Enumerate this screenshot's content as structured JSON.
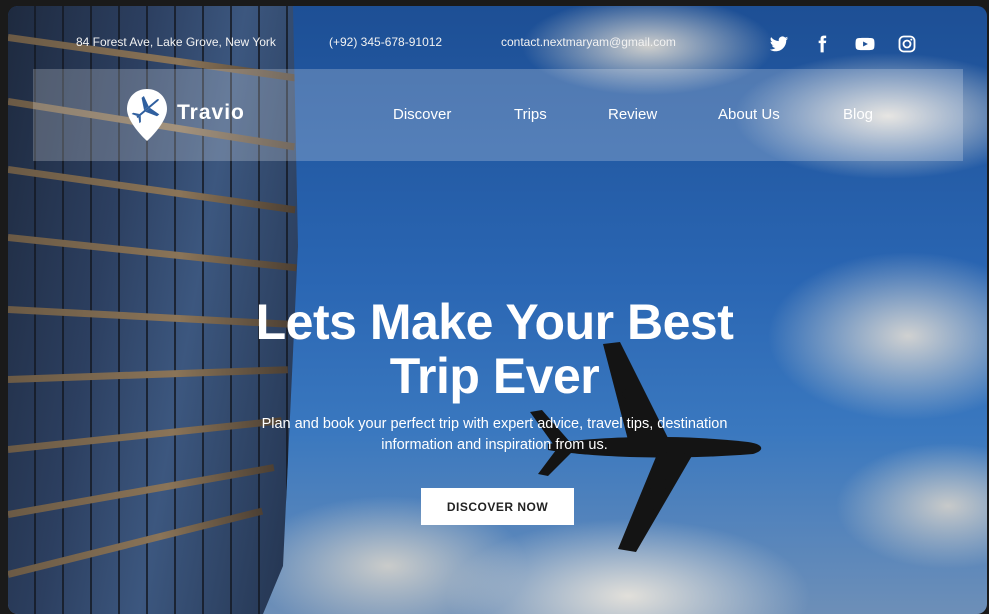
{
  "topbar": {
    "address": "84 Forest Ave, Lake Grove, New York",
    "phone": "(+92) 345-678-91012",
    "email": "contact.nextmaryam@gmail.com",
    "social": [
      "twitter-icon",
      "facebook-icon",
      "youtube-icon",
      "instagram-icon"
    ]
  },
  "brand": {
    "name": "Travio"
  },
  "nav": {
    "discover": "Discover",
    "trips": "Trips",
    "review": "Review",
    "about": "About Us",
    "blog": "Blog"
  },
  "hero": {
    "title_line1": "Lets Make Your Best",
    "title_line2": "Trip Ever",
    "subtitle_line1": "Plan and book your perfect trip with expert advice, travel tips, destination",
    "subtitle_line2": "information and inspiration from us.",
    "cta": "DISCOVER NOW"
  },
  "colors": {
    "sky": "#2a66b3",
    "navbar_overlay": "rgba(255,255,255,0.22)",
    "cta_bg": "#ffffff",
    "cta_text": "#222222"
  }
}
